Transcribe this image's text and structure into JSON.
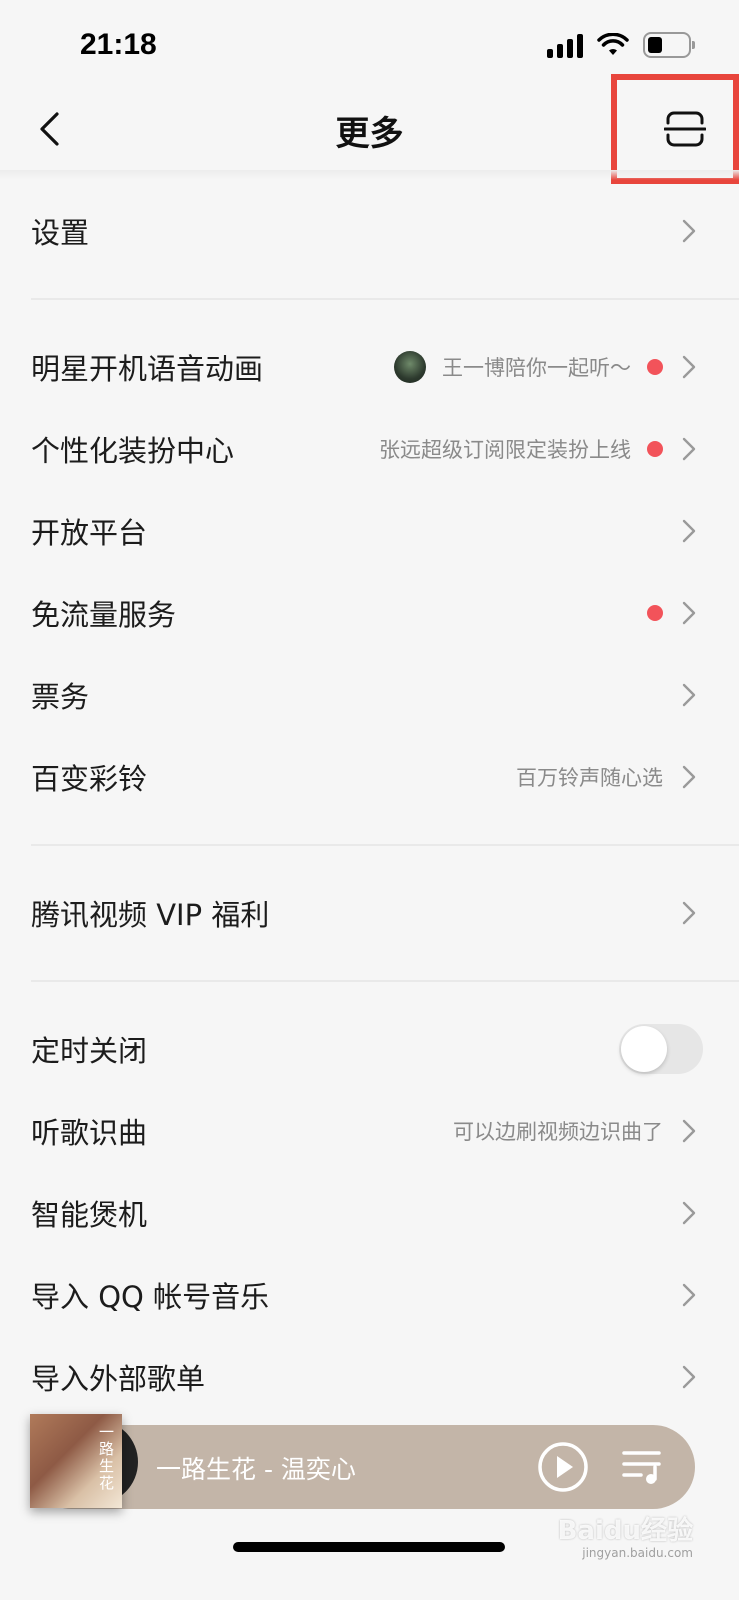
{
  "status_bar": {
    "time": "21:18"
  },
  "nav": {
    "title": "更多"
  },
  "sections": [
    [
      {
        "label": "设置"
      }
    ],
    [
      {
        "label": "明星开机语音动画",
        "hint": "王一博陪你一起听～",
        "avatar": true,
        "dot": true
      },
      {
        "label": "个性化装扮中心",
        "hint": "张远超级订阅限定装扮上线",
        "dot": true
      },
      {
        "label": "开放平台"
      },
      {
        "label": "免流量服务",
        "dot": true
      },
      {
        "label": "票务"
      },
      {
        "label": "百变彩铃",
        "hint": "百万铃声随心选"
      }
    ],
    [
      {
        "label": "腾讯视频 VIP 福利"
      }
    ],
    [
      {
        "label": "定时关闭",
        "toggle": true,
        "toggle_on": false
      },
      {
        "label": "听歌识曲",
        "hint": "可以边刷视频边识曲了"
      },
      {
        "label": "智能煲机"
      },
      {
        "label": "导入 QQ 帐号音乐"
      },
      {
        "label": "导入外部歌单"
      }
    ]
  ],
  "player": {
    "song": "一路生花 - 温奕心",
    "album_cover_text": "一路生花"
  },
  "watermark": {
    "main": "Baidu经验",
    "sub": "jingyan.baidu.com"
  },
  "colors": {
    "accent_red_dot": "#f2535a",
    "highlight_box": "#e8453c",
    "player_bg": "#c3b5a8"
  },
  "icons": {
    "back": "chevron-left-icon",
    "scan": "scan-icon",
    "row_arrow": "chevron-right-icon",
    "play": "play-circle-icon",
    "playlist": "playlist-icon"
  }
}
